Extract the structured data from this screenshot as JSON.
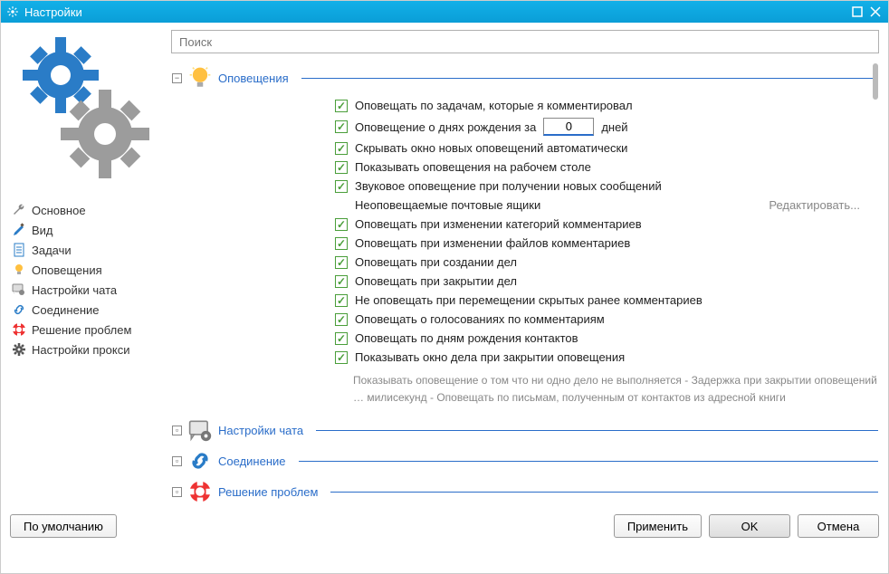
{
  "window": {
    "title": "Настройки"
  },
  "search": {
    "placeholder": "Поиск"
  },
  "nav": {
    "items": [
      {
        "label": "Основное",
        "icon": "wrench"
      },
      {
        "label": "Вид",
        "icon": "brush"
      },
      {
        "label": "Задачи",
        "icon": "document"
      },
      {
        "label": "Оповещения",
        "icon": "bulb"
      },
      {
        "label": "Настройки чата",
        "icon": "chat-gear"
      },
      {
        "label": "Соединение",
        "icon": "link"
      },
      {
        "label": "Решение проблем",
        "icon": "lifebuoy"
      },
      {
        "label": "Настройки прокси",
        "icon": "gear"
      }
    ]
  },
  "sections": {
    "notifications": {
      "title": "Оповещения",
      "expanded": true,
      "rows": [
        {
          "type": "check",
          "checked": true,
          "label": "Оповещать по задачам, которые я комментировал"
        },
        {
          "type": "check_num",
          "checked": true,
          "label_pre": "Оповещение о днях рождения за",
          "value": "0",
          "label_post": "дней"
        },
        {
          "type": "check",
          "checked": true,
          "label": "Скрывать окно новых оповещений автоматически"
        },
        {
          "type": "check",
          "checked": true,
          "label": "Показывать оповещения на рабочем столе"
        },
        {
          "type": "check",
          "checked": true,
          "label": "Звуковое оповещение при получении новых сообщений"
        },
        {
          "type": "link",
          "label": "Неоповещаемые почтовые ящики",
          "link": "Редактировать..."
        },
        {
          "type": "check",
          "checked": true,
          "label": "Оповещать при изменении категорий комментариев"
        },
        {
          "type": "check",
          "checked": true,
          "label": "Оповещать при изменении файлов комментариев"
        },
        {
          "type": "check",
          "checked": true,
          "label": "Оповещать при создании дел"
        },
        {
          "type": "check",
          "checked": true,
          "label": "Оповещать при закрытии дел"
        },
        {
          "type": "check",
          "checked": true,
          "label": "Не оповещать при перемещении скрытых ранее комментариев"
        },
        {
          "type": "check",
          "checked": true,
          "label": "Оповещать о голосованиях по комментариям"
        },
        {
          "type": "check",
          "checked": true,
          "label": "Оповещать по дням рождения контактов"
        },
        {
          "type": "check",
          "checked": true,
          "label": "Показывать окно дела при закрытии оповещения"
        }
      ],
      "footnote": "Показывать оповещение о том что ни одно дело не выполняется  -   Задержка при закрытии оповещений … милисекунд  -   Оповещать по письмам, полученным от контактов из адресной книги"
    },
    "chat": {
      "title": "Настройки чата",
      "expanded": false
    },
    "connection": {
      "title": "Соединение",
      "expanded": false
    },
    "troubleshoot": {
      "title": "Решение проблем",
      "expanded": false
    }
  },
  "buttons": {
    "defaults": "По умолчанию",
    "apply": "Применить",
    "ok": "OK",
    "cancel": "Отмена"
  }
}
